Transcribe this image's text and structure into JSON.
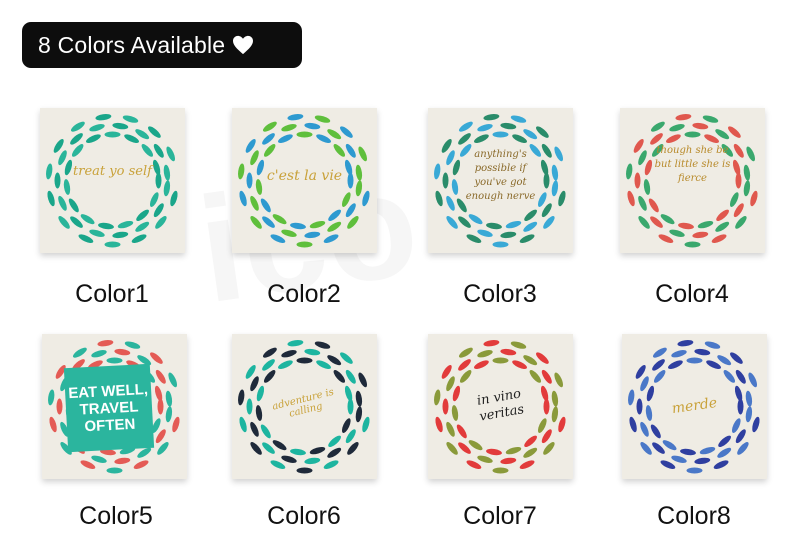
{
  "banner": {
    "text": "8 Colors Available",
    "icon": "heart-icon"
  },
  "products": [
    {
      "label": "Color1",
      "quote": "treat yo self",
      "palette": [
        "#1aa68a",
        "#2ab59a",
        "#d9b24a"
      ]
    },
    {
      "label": "Color2",
      "quote": "c'est la vie",
      "palette": [
        "#2e9ad0",
        "#5fbf3c",
        "#d9b24a"
      ]
    },
    {
      "label": "Color3",
      "quote": "anything's possible if you've got enough nerve",
      "palette": [
        "#2a8c6a",
        "#39a9d6",
        "#d9b24a"
      ]
    },
    {
      "label": "Color4",
      "quote": "though she be but little she is fierce",
      "palette": [
        "#e0584e",
        "#3aa86d",
        "#d9b24a"
      ]
    },
    {
      "label": "Color5",
      "quote": "EAT WELL, TRAVEL OFTEN",
      "palette": [
        "#e45b55",
        "#2bb59e",
        "#ffffff"
      ]
    },
    {
      "label": "Color6",
      "quote": "adventure is calling",
      "palette": [
        "#1db5a0",
        "#1f2a3a",
        "#d9b24a"
      ]
    },
    {
      "label": "Color7",
      "quote": "in vino veritas",
      "palette": [
        "#e23b3b",
        "#8a9a3a",
        "#222222"
      ]
    },
    {
      "label": "Color8",
      "quote": "merde",
      "palette": [
        "#2f3fa0",
        "#4a78c8",
        "#d9b24a"
      ]
    }
  ]
}
